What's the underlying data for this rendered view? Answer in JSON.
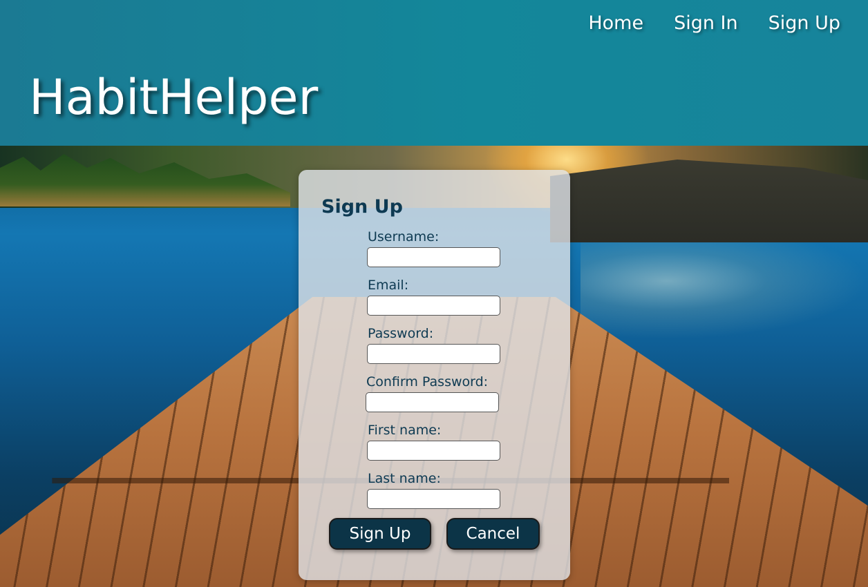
{
  "nav": {
    "home": "Home",
    "sign_in": "Sign In",
    "sign_up": "Sign Up"
  },
  "brand": "HabitHelper",
  "form": {
    "title": "Sign Up",
    "fields": [
      {
        "label": "Username:",
        "value": "",
        "placeholder": ""
      },
      {
        "label": "Email:",
        "value": "",
        "placeholder": ""
      },
      {
        "label": "Password:",
        "value": "",
        "placeholder": ""
      },
      {
        "label": "Confirm Password:",
        "value": "",
        "placeholder": ""
      },
      {
        "label": "First name:",
        "value": "",
        "placeholder": ""
      },
      {
        "label": "Last name:",
        "value": "",
        "placeholder": ""
      }
    ],
    "submit_label": "Sign Up",
    "cancel_label": "Cancel"
  },
  "colors": {
    "header": "#13879a",
    "button": "#0c3447",
    "title_text": "#0e3a52"
  }
}
